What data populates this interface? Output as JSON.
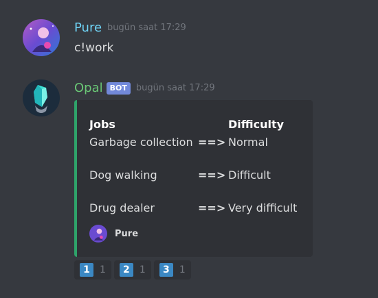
{
  "messages": [
    {
      "username": "Pure",
      "timestamp": "bugün saat 17:29",
      "content": "c!work"
    },
    {
      "username": "Opal",
      "bot_tag": "BOT",
      "timestamp": "bugün saat 17:29",
      "embed": {
        "header": {
          "job": "Jobs",
          "difficulty": "Difficulty"
        },
        "rows": [
          {
            "job": "Garbage collection",
            "arrow": "==>",
            "difficulty": "Normal"
          },
          {
            "job": "Dog walking",
            "arrow": "==>",
            "difficulty": "Difficult"
          },
          {
            "job": "Drug dealer",
            "arrow": "==>",
            "difficulty": "Very difficult"
          }
        ],
        "footer": "Pure",
        "accent_color": "#2ea36a"
      },
      "reactions": [
        {
          "emoji": "1",
          "count": "1"
        },
        {
          "emoji": "2",
          "count": "1"
        },
        {
          "emoji": "3",
          "count": "1"
        }
      ]
    }
  ],
  "colors": {
    "background": "#36393f",
    "pure_name": "#6fd3f5",
    "opal_name": "#6ac776",
    "bot_tag": "#7289da",
    "keycap": "#3b88c3"
  }
}
